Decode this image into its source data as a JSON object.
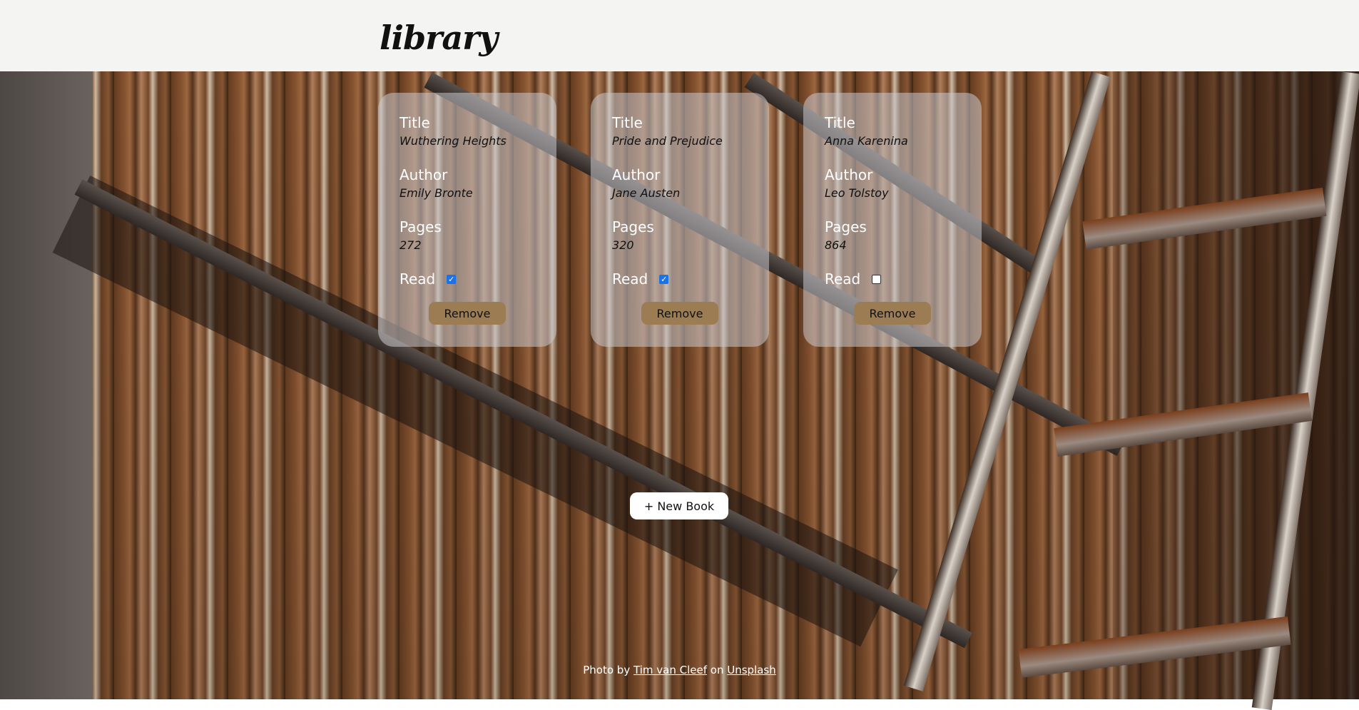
{
  "header": {
    "logo": "library"
  },
  "books": [
    {
      "title_label": "Title",
      "title": "Wuthering Heights",
      "author_label": "Author",
      "author": "Emily Bronte",
      "pages_label": "Pages",
      "pages": "272",
      "read_label": "Read",
      "read": true,
      "remove_label": "Remove"
    },
    {
      "title_label": "Title",
      "title": "Pride and Prejudice",
      "author_label": "Author",
      "author": "Jane Austen",
      "pages_label": "Pages",
      "pages": "320",
      "read_label": "Read",
      "read": true,
      "remove_label": "Remove"
    },
    {
      "title_label": "Title",
      "title": "Anna Karenina",
      "author_label": "Author",
      "author": "Leo Tolstoy",
      "pages_label": "Pages",
      "pages": "864",
      "read_label": "Read",
      "read": false,
      "remove_label": "Remove"
    }
  ],
  "new_book_label": "+ New Book",
  "credit": {
    "prefix": "Photo by",
    "photographer": "Tim van Cleef",
    "middle": "on",
    "site": "Unsplash"
  },
  "colors": {
    "remove_button": "#9c7c53",
    "header_bg": "#f4f4f3",
    "checkbox_checked": "#1a73e8"
  }
}
